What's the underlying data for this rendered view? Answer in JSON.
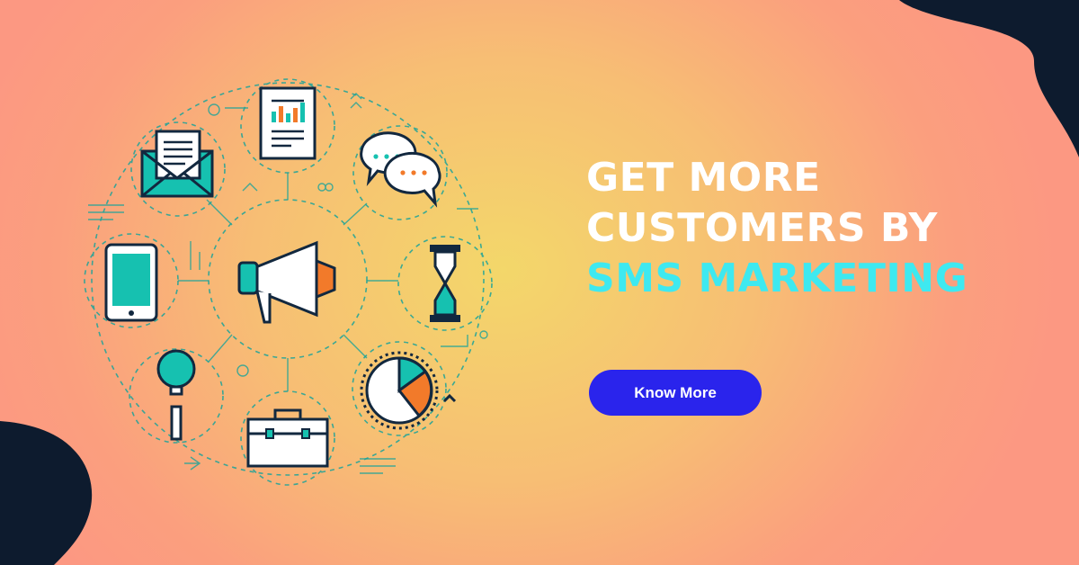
{
  "headline": {
    "line1": "GET MORE",
    "line2": "CUSTOMERS BY",
    "line3": "SMS MARKETING"
  },
  "cta": {
    "label": "Know More"
  },
  "colors": {
    "background_center": "#f3d76a",
    "background_edge": "#fc9882",
    "corner_blob": "#0d1b2e",
    "headline_white": "#ffffff",
    "headline_accent": "#3ee9f0",
    "button": "#2a24ec",
    "icon_teal": "#16c1b0",
    "icon_outline": "#12283f",
    "icon_orange": "#f27a2a"
  },
  "icons": [
    "email-icon",
    "report-icon",
    "chat-bubbles-icon",
    "smartphone-icon",
    "megaphone-icon",
    "hourglass-icon",
    "magnifier-icon",
    "briefcase-icon",
    "pie-chart-icon"
  ]
}
